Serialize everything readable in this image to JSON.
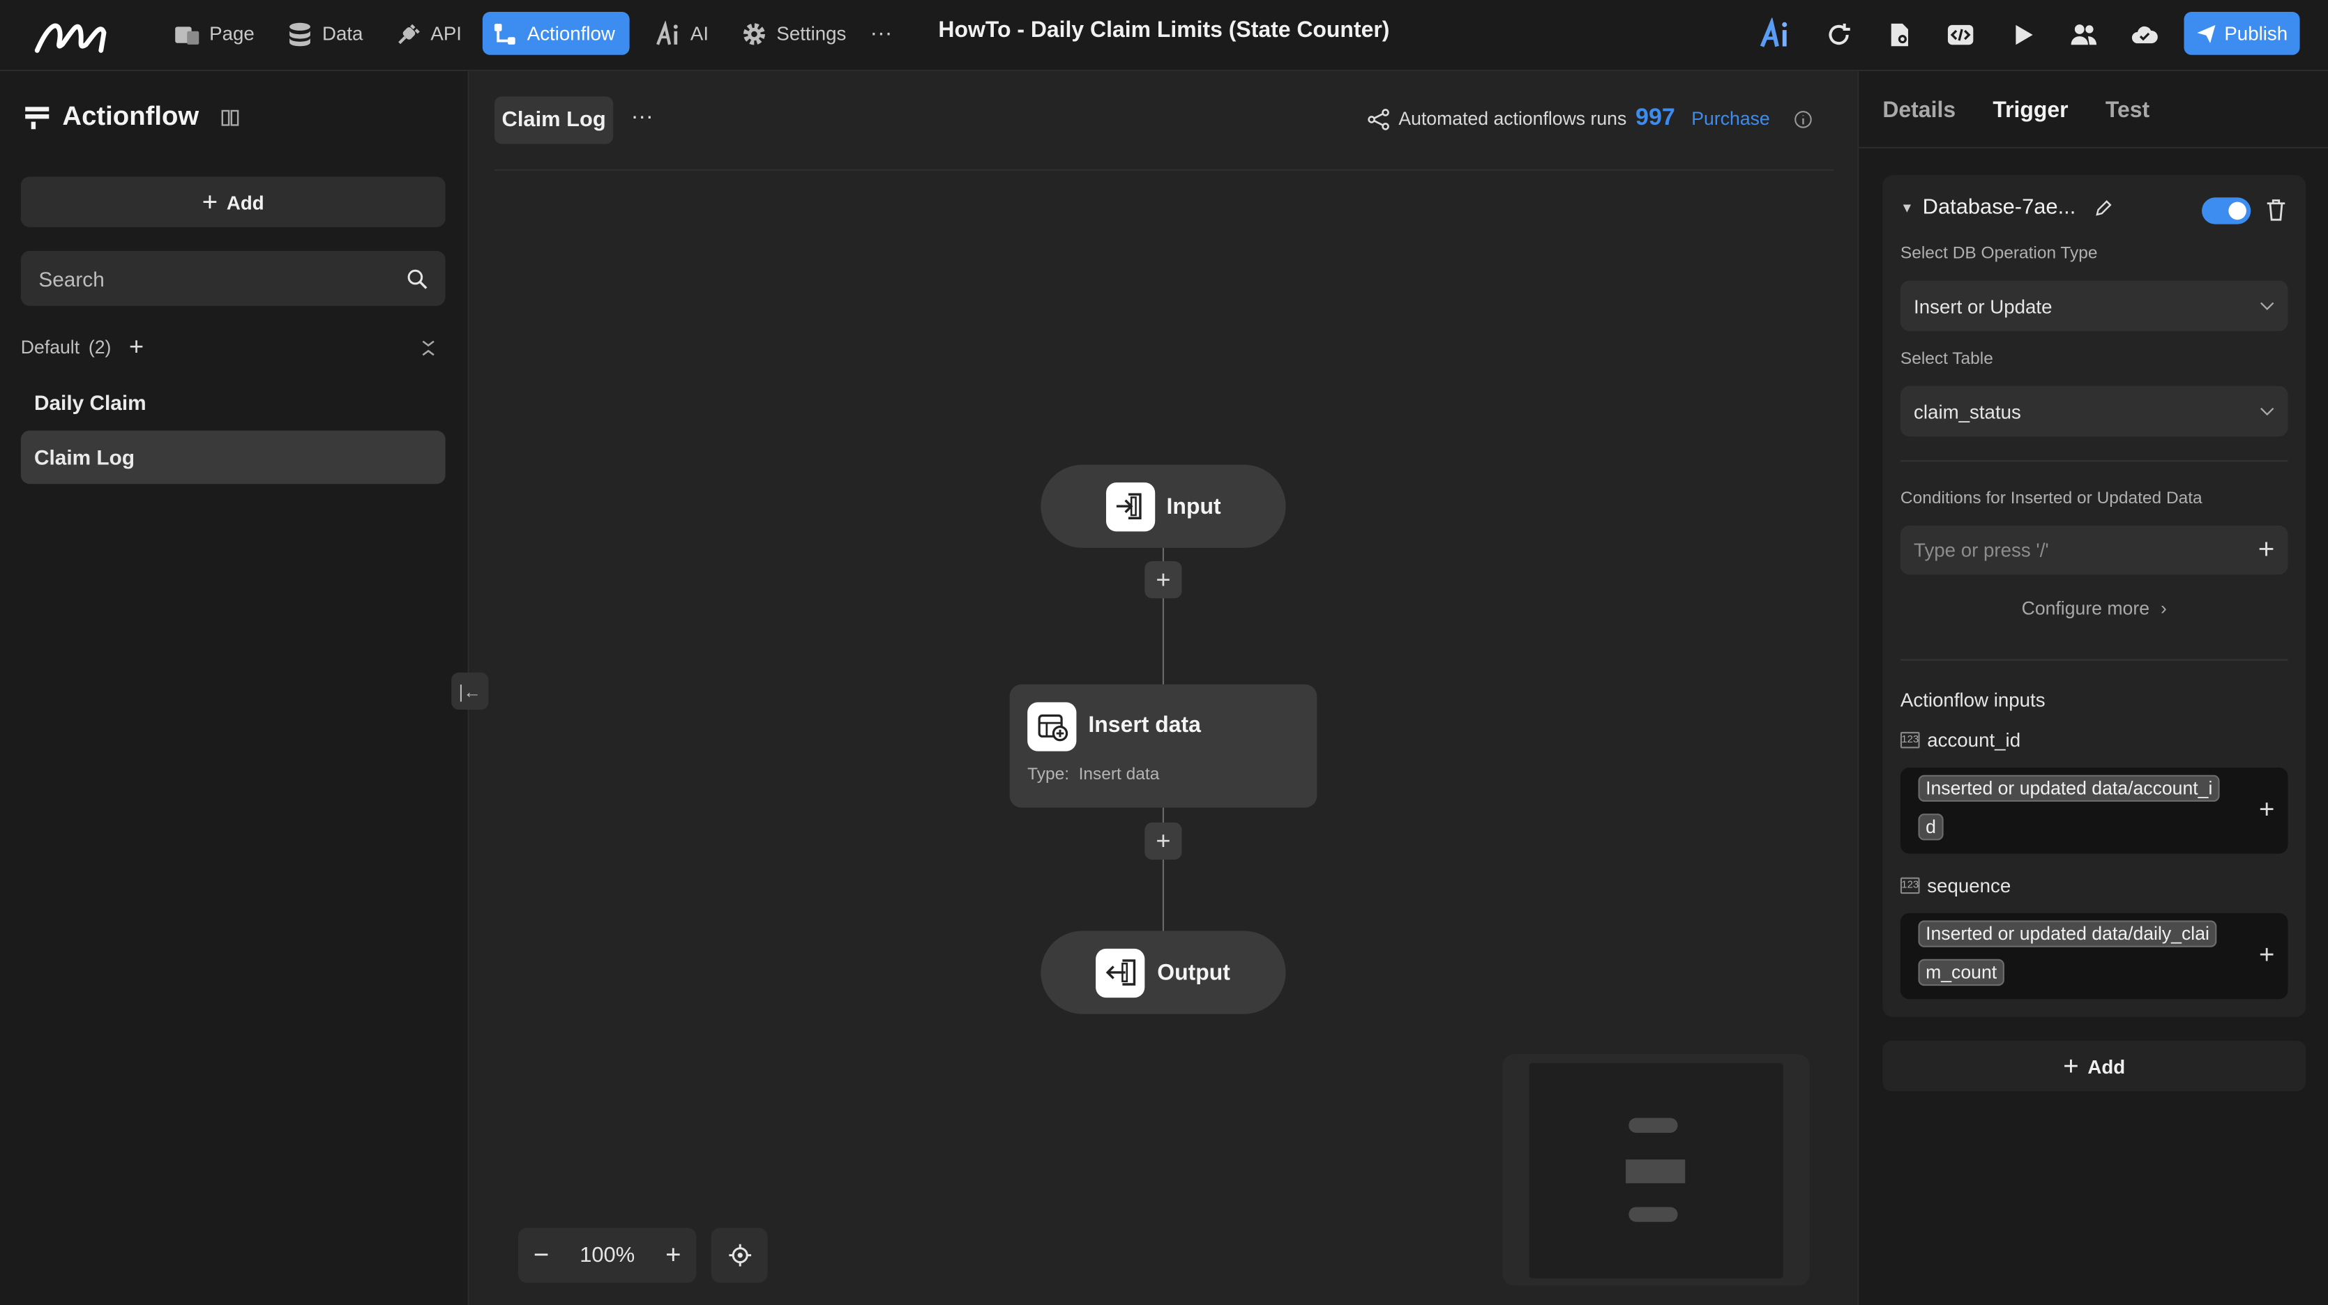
{
  "topbar": {
    "nav": [
      {
        "label": "Page",
        "icon": "page-icon"
      },
      {
        "label": "Data",
        "icon": "database-icon"
      },
      {
        "label": "API",
        "icon": "plug-icon"
      },
      {
        "label": "Actionflow",
        "icon": "flow-icon",
        "active": true
      },
      {
        "label": "AI",
        "icon": "ai-icon"
      },
      {
        "label": "Settings",
        "icon": "gear-icon"
      }
    ],
    "more": "···",
    "title": "HowTo - Daily Claim Limits (State Counter)",
    "publish_label": "Publish"
  },
  "sidebar": {
    "title": "Actionflow",
    "add_label": "Add",
    "search_placeholder": "Search",
    "group_label": "Default",
    "group_count": "(2)",
    "items": [
      {
        "label": "Daily Claim",
        "selected": false
      },
      {
        "label": "Claim Log",
        "selected": true
      }
    ]
  },
  "canvas": {
    "tab": "Claim Log",
    "more": "···",
    "runs_label": "Automated actionflows runs",
    "runs_count": "997",
    "purchase_label": "Purchase",
    "nodes": {
      "input_label": "Input",
      "insert_title": "Insert data",
      "insert_type": "Type:  Insert data",
      "output_label": "Output"
    },
    "zoom": "100%",
    "collapse_icon": "|←"
  },
  "right_panel": {
    "tabs": [
      "Details",
      "Trigger",
      "Test"
    ],
    "active_tab": "Trigger",
    "trigger_name": "Database-7ae...",
    "enabled": true,
    "db_op_label": "Select DB Operation Type",
    "db_op_value": "Insert or Update",
    "table_label": "Select Table",
    "table_value": "claim_status",
    "conditions_label": "Conditions for Inserted or Updated Data",
    "conditions_placeholder": "Type or press '/'",
    "configure_more": "Configure more",
    "inputs_title": "Actionflow inputs",
    "inputs": [
      {
        "name": "account_id",
        "token_line1": "Inserted or updated data/account_i",
        "token_line2": "d"
      },
      {
        "name": "sequence",
        "token_line1": "Inserted or updated data/daily_clai",
        "token_line2": "m_count"
      }
    ],
    "add_label": "Add"
  },
  "colors": {
    "accent": "#3d8df0",
    "background": "#1b1b1b",
    "canvas": "#242424"
  }
}
